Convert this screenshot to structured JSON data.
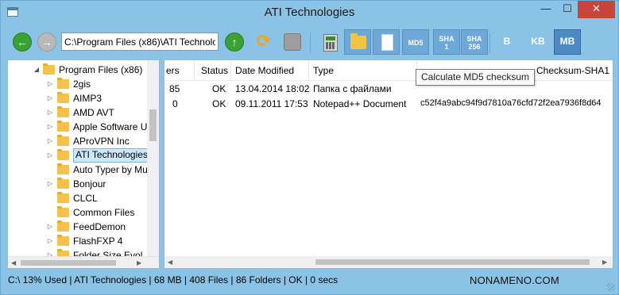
{
  "window": {
    "title": "ATI Technologies",
    "controls": {
      "minimize": "—",
      "maximize": "☐",
      "close": "✕"
    }
  },
  "toolbar": {
    "path_value": "C:\\Program Files (x86)\\ATI Technologies",
    "buttons": {
      "md5": "MD5",
      "sha1_line1": "SHA",
      "sha1_line2": "1",
      "sha256_line1": "SHA",
      "sha256_line2": "256",
      "b": "B",
      "kb": "KB",
      "mb": "MB"
    },
    "icons": [
      "back-arrow-icon",
      "forward-arrow-icon",
      "up-arrow-icon",
      "refresh-icon",
      "stop-icon",
      "calculator-icon",
      "folder-icon",
      "document-icon"
    ],
    "selected_unit": "MB"
  },
  "tree": {
    "items": [
      {
        "label": "Program Files (x86)",
        "expanded": true
      },
      {
        "label": "2gis"
      },
      {
        "label": "AIMP3"
      },
      {
        "label": "AMD AVT"
      },
      {
        "label": "Apple Software U"
      },
      {
        "label": "AProVPN Inc"
      },
      {
        "label": "ATI Technologies",
        "selected": true
      },
      {
        "label": "Auto Typer by Mu"
      },
      {
        "label": "Bonjour"
      },
      {
        "label": "CLCL"
      },
      {
        "label": "Common Files"
      },
      {
        "label": "FeedDemon"
      },
      {
        "label": "FlashFXP 4"
      },
      {
        "label": "Folder Size Evol"
      }
    ]
  },
  "list": {
    "columns": {
      "col0": "ers",
      "status": "Status",
      "date_modified": "Date Modified",
      "type": "Type",
      "checksum": "Checksum-SHA1"
    },
    "rows": [
      {
        "col0": "85",
        "status": "OK",
        "date_modified": "13.04.2014 18:02",
        "type": "Папка с файлами",
        "checksum": ""
      },
      {
        "col0": "0",
        "status": "OK",
        "date_modified": "09.11.2011 17:53",
        "type": "Notepad++ Document",
        "checksum": "c52f4a9abc94f9d7810a76cfd72f2ea7936f8d64"
      }
    ]
  },
  "tooltip": {
    "text": "Calculate MD5 checksum"
  },
  "statusbar": {
    "text": "C:\\ 13% Used  |  ATI Technologies  |  68  MB  |  408 Files  |  86 Folders  |  OK  |  0 secs",
    "brand": "NONAMENO.COM"
  },
  "colors": {
    "chrome": "#8bc3e6",
    "button": "#6ea8d8",
    "selected_button": "#4d8ac2",
    "nav_green": "#3aa135",
    "close_red": "#c7453a",
    "tree_selected": "#cce8ff"
  }
}
